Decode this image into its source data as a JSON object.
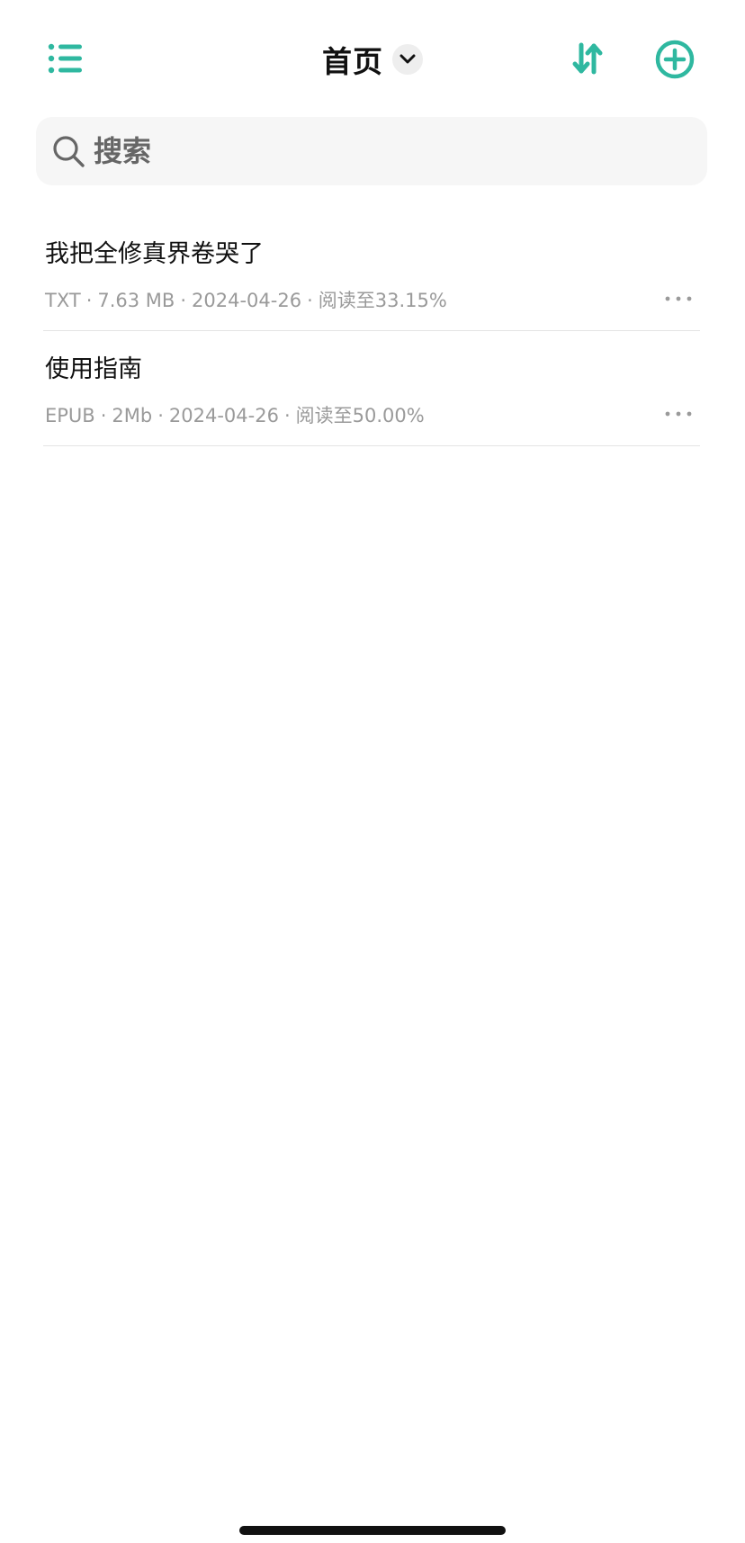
{
  "header": {
    "title": "首页",
    "icons": {
      "menu": "list-menu-icon",
      "title_dropdown": "chevron-down-icon",
      "sort": "sort-arrows-icon",
      "add": "plus-circle-icon"
    },
    "accent_color": "#2fb8a0"
  },
  "search": {
    "placeholder": "搜索",
    "value": "",
    "icon": "search-icon"
  },
  "books": [
    {
      "title": "我把全修真界卷哭了",
      "format": "TXT",
      "size": "7.63 MB",
      "date": "2024-04-26",
      "progress": "阅读至33.15%"
    },
    {
      "title": "使用指南",
      "format": "EPUB",
      "size": "2Mb",
      "date": "2024-04-26",
      "progress": "阅读至50.00%"
    }
  ]
}
